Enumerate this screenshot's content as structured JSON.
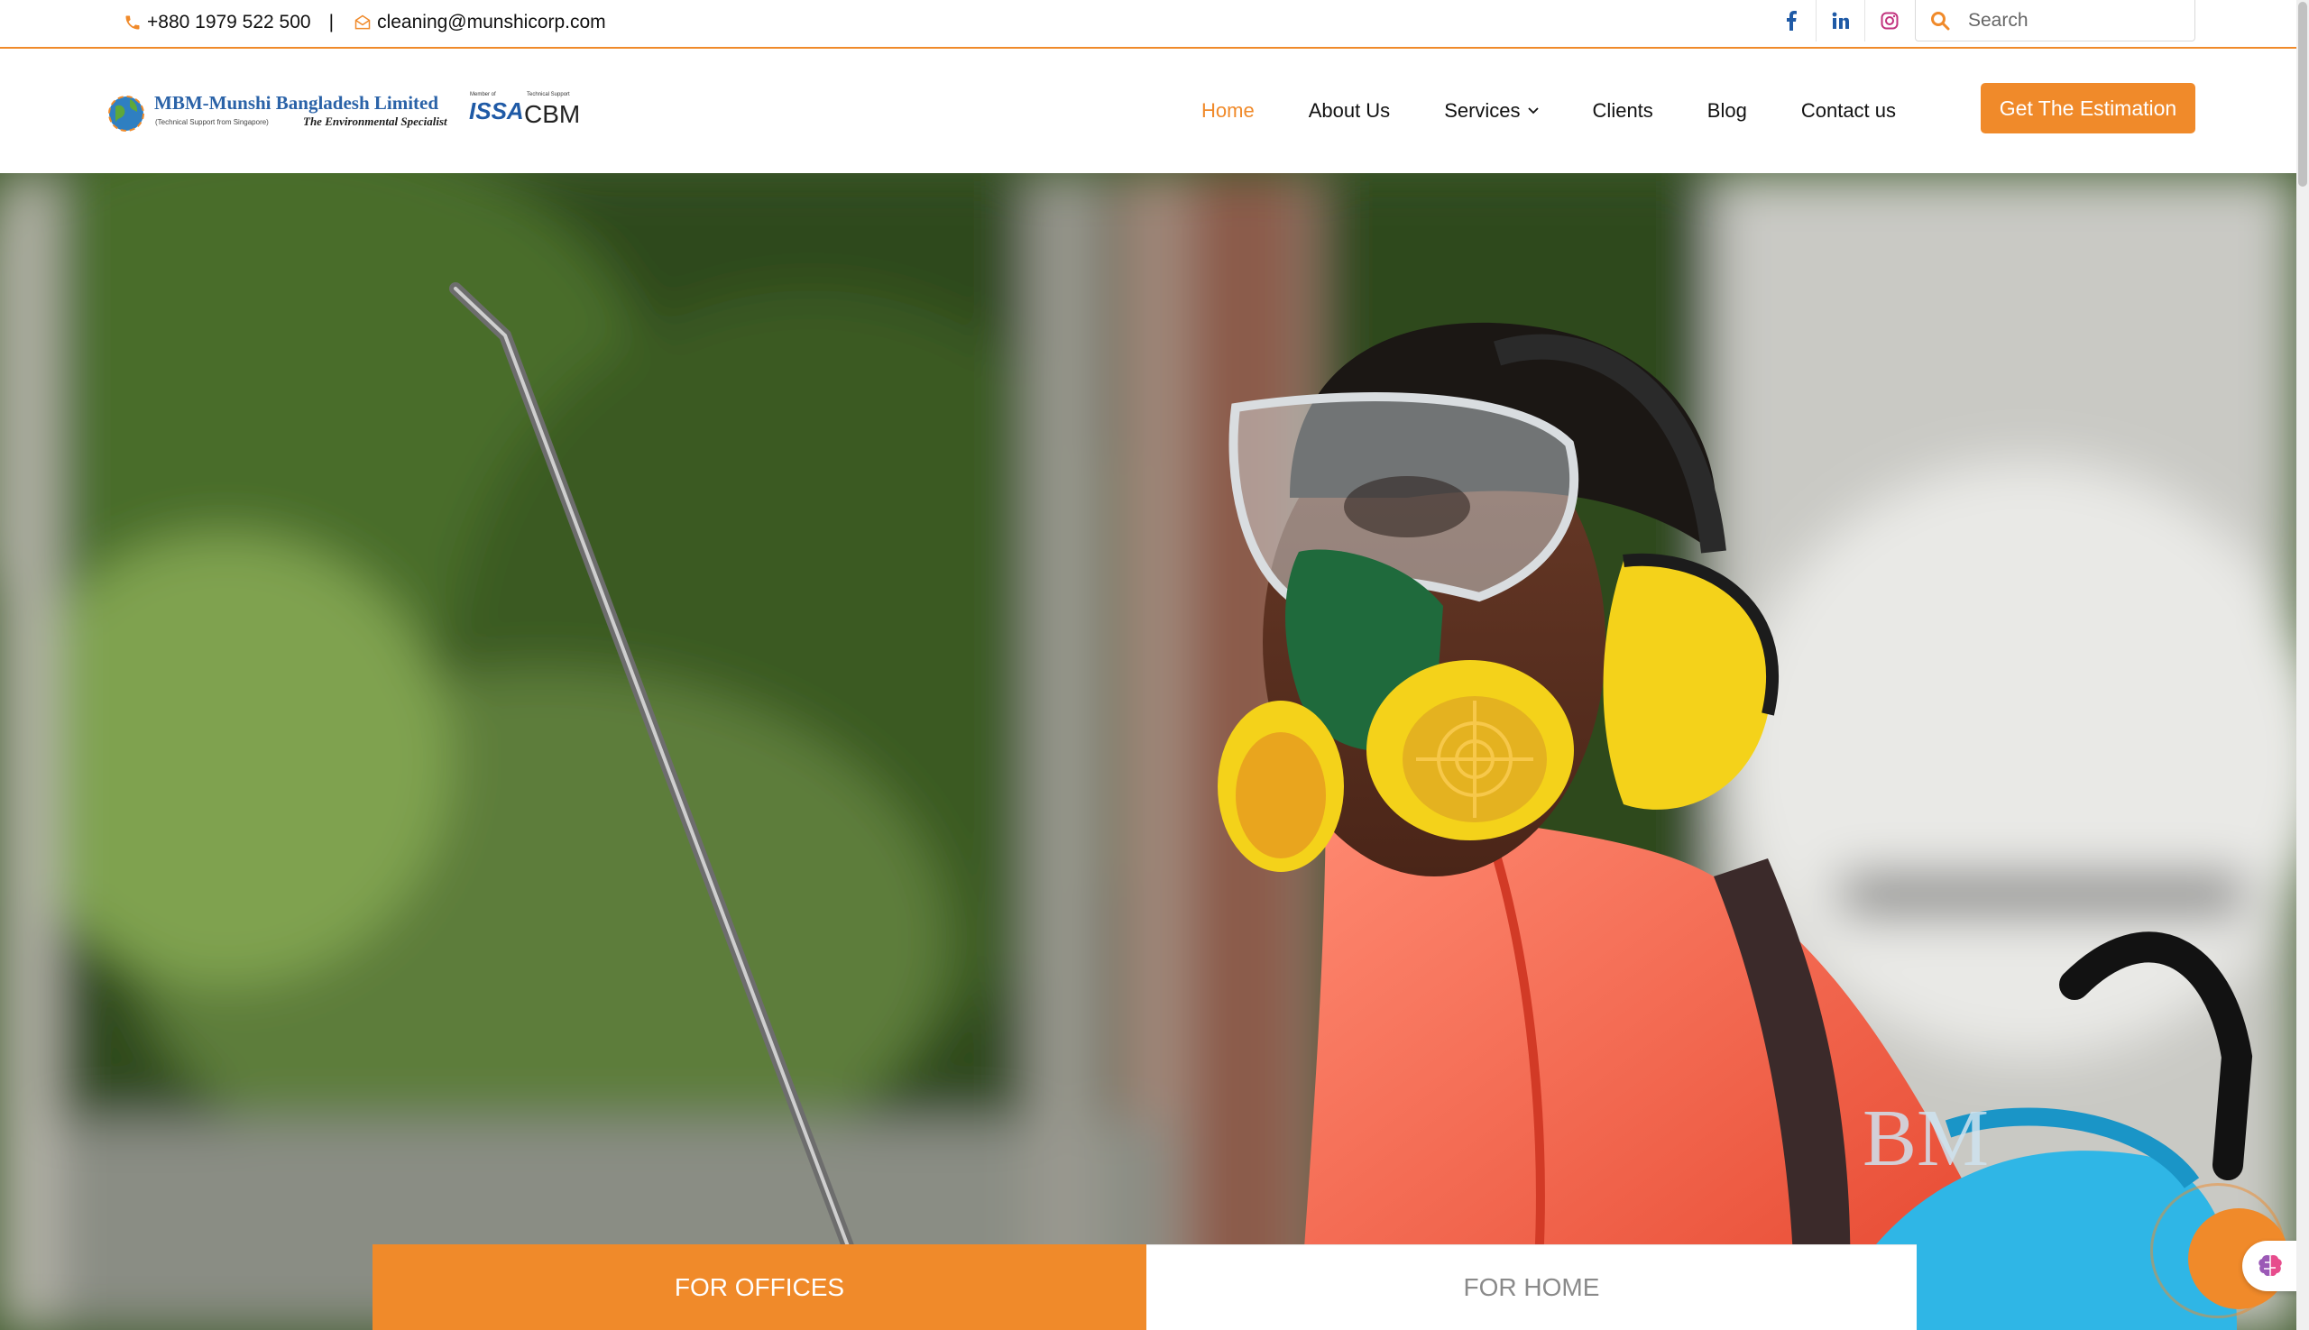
{
  "topbar": {
    "phone": "+880 1979 522 500",
    "separator": "|",
    "email": "cleaning@munshicorp.com",
    "socials": [
      "facebook-icon",
      "linkedin-icon",
      "instagram-icon"
    ],
    "search_placeholder": "Search"
  },
  "header": {
    "logo": {
      "company_name": "MBM-Munshi Bangladesh Limited",
      "tagline_small": "(Technical Support from Singapore)",
      "tagline": "The Environmental Specialist",
      "badge_issa_caption": "Member of",
      "badge_issa": "ISSA",
      "badge_cbm_caption": "Technical Support",
      "badge_cbm": "CBM"
    },
    "nav": [
      {
        "label": "Home",
        "active": true
      },
      {
        "label": "About Us",
        "active": false
      },
      {
        "label": "Services",
        "active": false,
        "dropdown": true
      },
      {
        "label": "Clients",
        "active": false
      },
      {
        "label": "Blog",
        "active": false
      },
      {
        "label": "Contact us",
        "active": false
      }
    ],
    "cta_label": "Get The Estimation"
  },
  "hero": {
    "tabs": [
      {
        "label": "FOR OFFICES",
        "active": true
      },
      {
        "label": "FOR HOME",
        "active": false
      }
    ],
    "image": "worker-in-protective-gear-photo"
  },
  "colors": {
    "accent": "#f08a2a",
    "text": "#111111",
    "muted": "#8a8a8a"
  }
}
